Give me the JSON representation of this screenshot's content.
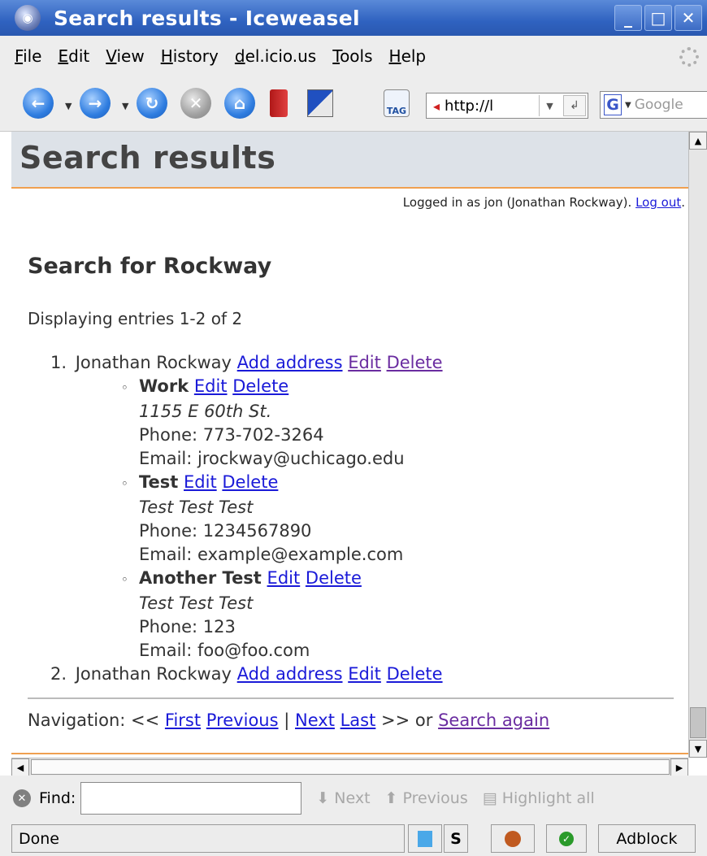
{
  "window": {
    "title": "Search results - Iceweasel"
  },
  "menu": {
    "items": [
      "File",
      "Edit",
      "View",
      "History",
      "del.icio.us",
      "Tools",
      "Help"
    ]
  },
  "toolbar": {
    "url_value": "http://l",
    "search_placeholder": "Google",
    "tag_label": "TAG"
  },
  "page": {
    "header": "Search results",
    "logged_in_text": "Logged in as jon (Jonathan Rockway).",
    "logout_label": "Log out",
    "logout_suffix": ".",
    "search_title": "Search for Rockway",
    "displaying": "Displaying entries 1-2 of 2",
    "entries": [
      {
        "num": "1.",
        "name": "Jonathan Rockway",
        "add_address": "Add address",
        "edit": "Edit",
        "delete": "Delete",
        "addresses": [
          {
            "label": "Work",
            "edit": "Edit",
            "delete": "Delete",
            "street": "1155 E 60th St.",
            "phone": "Phone: 773-702-3264",
            "email": "Email: jrockway@uchicago.edu"
          },
          {
            "label": "Test",
            "edit": "Edit",
            "delete": "Delete",
            "street": "Test Test Test",
            "phone": "Phone: 1234567890",
            "email": "Email: example@example.com"
          },
          {
            "label": "Another Test",
            "edit": "Edit",
            "delete": "Delete",
            "street": "Test Test Test",
            "phone": "Phone: 123",
            "email": "Email: foo@foo.com"
          }
        ]
      },
      {
        "num": "2.",
        "name": "Jonathan Rockway",
        "add_address": "Add address",
        "edit": "Edit",
        "delete": "Delete",
        "addresses": []
      }
    ],
    "navigation": {
      "label": "Navigation: <<",
      "first": "First",
      "previous": "Previous",
      "sep": "|",
      "next": "Next",
      "last": "Last",
      "or": ">> or",
      "search_again": "Search again"
    }
  },
  "findbar": {
    "label": "Find:",
    "value": "",
    "next": "Next",
    "previous": "Previous",
    "highlight": "Highlight all"
  },
  "status": {
    "text": "Done",
    "adblock": "Adblock"
  }
}
